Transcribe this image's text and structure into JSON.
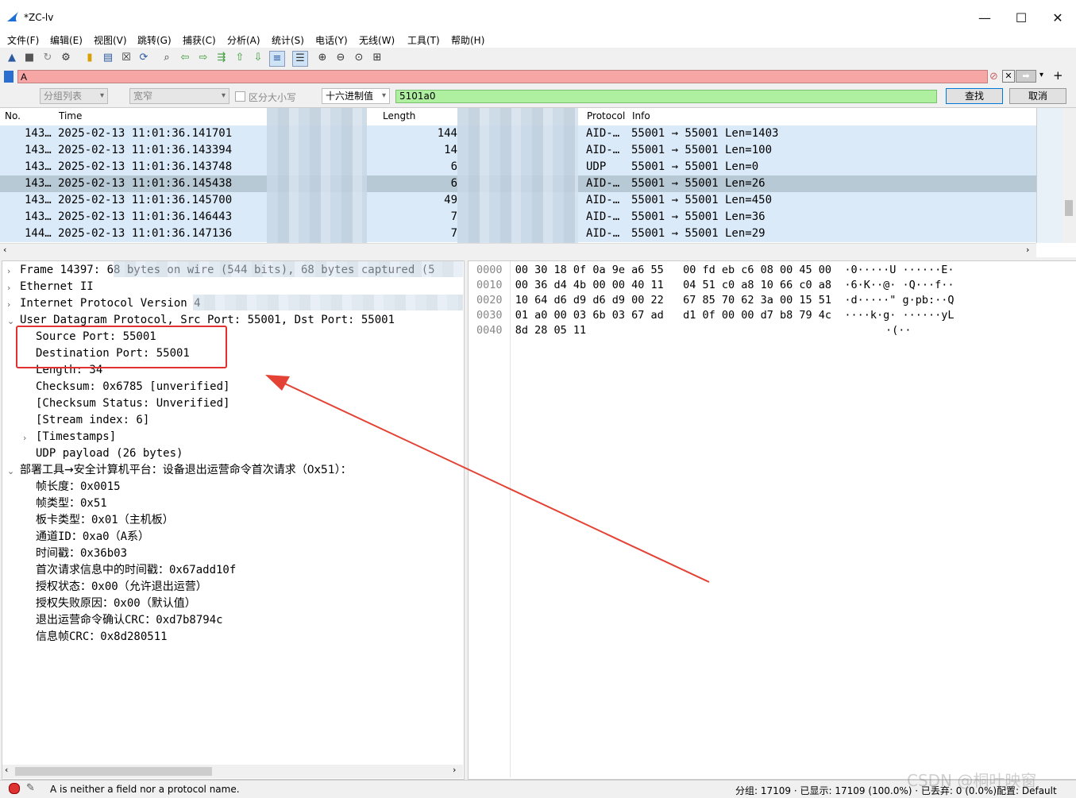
{
  "window": {
    "title": "*ZC-lv",
    "minimize": "—",
    "maximize": "☐",
    "close": "✕"
  },
  "menu": [
    "文件(F)",
    "编辑(E)",
    "视图(V)",
    "跳转(G)",
    "捕获(C)",
    "分析(A)",
    "统计(S)",
    "电话(Y)",
    "无线(W)",
    "工具(T)",
    "帮助(H)"
  ],
  "filter": {
    "value": "A"
  },
  "find": {
    "scope": "分组列表",
    "charset": "宽窄",
    "case_label": "区分大小写",
    "type": "十六进制值",
    "value": "5101a0",
    "find_button": "查找",
    "cancel_button": "取消"
  },
  "packet_list": {
    "columns": {
      "no": "No.",
      "time": "Time",
      "length": "Length",
      "protocol": "Protocol",
      "info": "Info"
    },
    "rows": [
      {
        "no": "143…",
        "time": "2025-02-13 11:01:36.141701",
        "length": "144",
        "protocol": "AID-…",
        "info": "55001 → 55001 Len=1403"
      },
      {
        "no": "143…",
        "time": "2025-02-13 11:01:36.143394",
        "length": "14",
        "protocol": "AID-…",
        "info": "55001 → 55001 Len=100"
      },
      {
        "no": "143…",
        "time": "2025-02-13 11:01:36.143748",
        "length": "6",
        "protocol": "UDP",
        "info": "55001 → 55001 Len=0"
      },
      {
        "no": "143…",
        "time": "2025-02-13 11:01:36.145438",
        "length": "6",
        "protocol": "AID-…",
        "info": "55001 → 55001 Len=26",
        "selected": true
      },
      {
        "no": "143…",
        "time": "2025-02-13 11:01:36.145700",
        "length": "49",
        "protocol": "AID-…",
        "info": "55001 → 55001 Len=450"
      },
      {
        "no": "143…",
        "time": "2025-02-13 11:01:36.146443",
        "length": "7",
        "protocol": "AID-…",
        "info": "55001 → 55001 Len=36"
      },
      {
        "no": "144…",
        "time": "2025-02-13 11:01:36.147136",
        "length": "7",
        "protocol": "AID-…",
        "info": "55001 → 55001 Len=29"
      }
    ]
  },
  "details": {
    "frame": "Frame 14397: 68 bytes on wire (544 bits), 68 bytes captured (5",
    "ethernet": "Ethernet II",
    "ip": "Internet Protocol Version 4",
    "udp": "User Datagram Protocol, Src Port: 55001, Dst Port: 55001",
    "udp_fields": [
      "Source Port: 55001",
      "Destination Port: 55001",
      "Length: 34",
      "Checksum: 0x6785 [unverified]",
      "[Checksum Status: Unverified]",
      "[Stream index: 6]",
      "[Timestamps]",
      "UDP payload (26 bytes)"
    ],
    "proto": "部署工具→安全计算机平台：设备退出运营命令首次请求（0x51）：",
    "proto_fields": [
      "帧长度：0x0015",
      "帧类型：0x51",
      "板卡类型：0x01（主机板）",
      "通道ID：0xa0（A系）",
      "时间戳：0x36b03",
      "首次请求信息中的时间戳：0x67add10f",
      "授权状态：0x00（允许退出运营）",
      "授权失败原因：0x00（默认值）",
      "退出运营命令确认CRC：0xd7b8794c",
      "信息帧CRC：0x8d280511"
    ]
  },
  "bytes": [
    {
      "offset": "0000",
      "hex": "00 30 18 0f 0a 9e a6 55   00 fd eb c6 08 00 45 00",
      "ascii": "·0·····U ······E·"
    },
    {
      "offset": "0010",
      "hex": "00 36 d4 4b 00 00 40 11   04 51 c0 a8 10 66 c0 a8",
      "ascii": "·6·K··@· ·Q···f··"
    },
    {
      "offset": "0020",
      "hex": "10 64 d6 d9 d6 d9 00 22   67 85 70 62 3a 00 15 51",
      "ascii": "·d·····\" g·pb:··Q"
    },
    {
      "offset": "0030",
      "hex": "01 a0 00 03 6b 03 67 ad   d1 0f 00 00 d7 b8 79 4c",
      "ascii": "····k·g· ······yL"
    },
    {
      "offset": "0040",
      "hex": "8d 28 05 11",
      "ascii": "·(··"
    }
  ],
  "status": {
    "message": "A is neither a field nor a protocol name.",
    "stats": "分组: 17109 · 已显示: 17109 (100.0%) · 已丢弃: 0 (0.0%)",
    "profile": "配置: Default",
    "watermark": "CSDN @桐叶映窗"
  }
}
